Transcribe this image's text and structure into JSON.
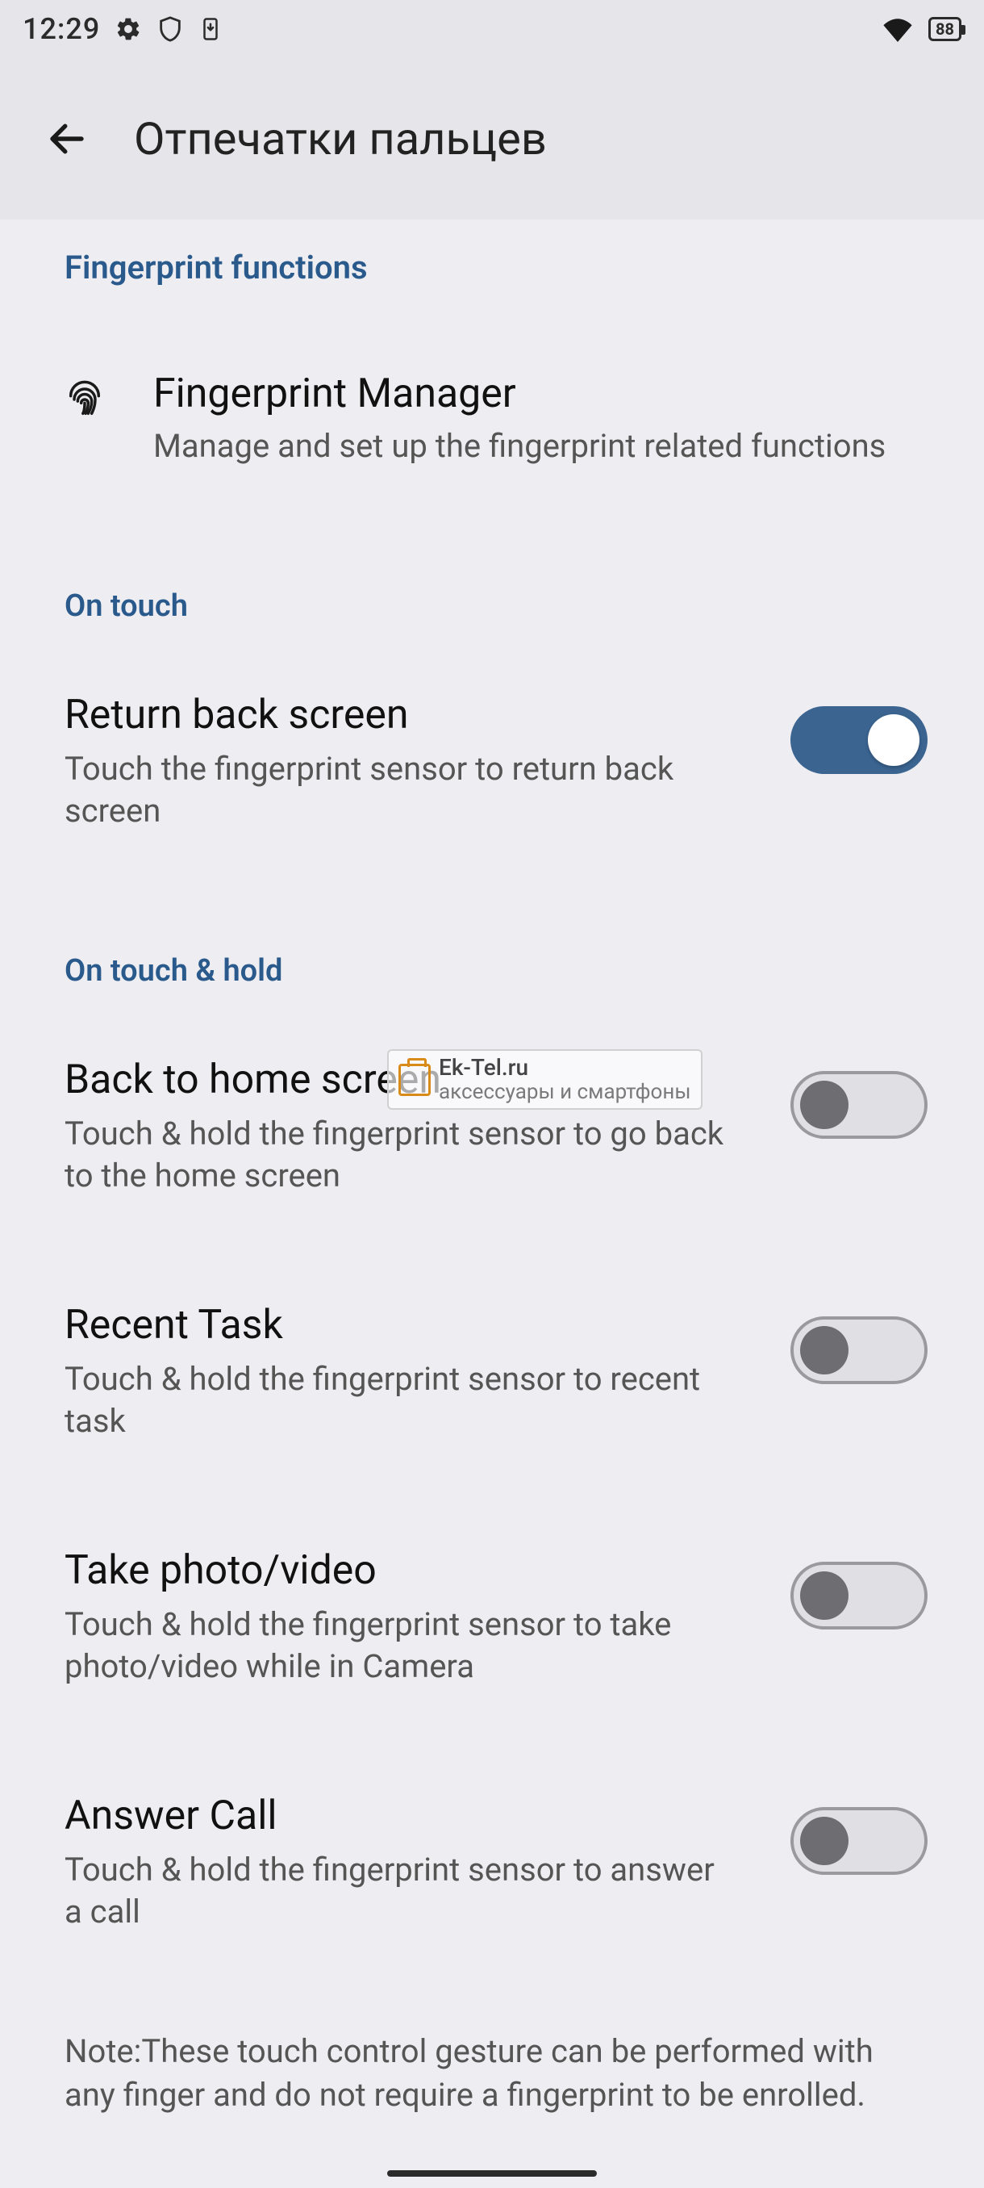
{
  "status": {
    "time": "12:29",
    "battery": "88"
  },
  "header": {
    "title": "Отпечатки пальцев"
  },
  "sections": {
    "functions_header": "Fingerprint functions",
    "on_touch_header": "On touch",
    "on_touch_hold_header": "On touch & hold"
  },
  "fingerprint_manager": {
    "title": "Fingerprint Manager",
    "summary": "Manage and set up the fingerprint related functions"
  },
  "return_back": {
    "title": "Return back screen",
    "summary": "Touch the fingerprint sensor to return back screen",
    "enabled": true
  },
  "back_home": {
    "title": "Back to home screen",
    "summary": "Touch & hold the fingerprint sensor to go back to the home screen",
    "enabled": false
  },
  "recent_task": {
    "title": "Recent Task",
    "summary": "Touch & hold the fingerprint sensor to recent task",
    "enabled": false
  },
  "take_photo": {
    "title": "Take photo/video",
    "summary": "Touch & hold the fingerprint sensor to take photo/video while in Camera",
    "enabled": false
  },
  "answer_call": {
    "title": "Answer Call",
    "summary": "Touch & hold the fingerprint sensor to answer a call",
    "enabled": false
  },
  "note": "Note:These touch control gesture can be performed with any finger and do not require a fingerprint to be enrolled.",
  "watermark": {
    "brand": "Ek-Tel.ru",
    "tagline": "аксессуары и смартфоны"
  }
}
